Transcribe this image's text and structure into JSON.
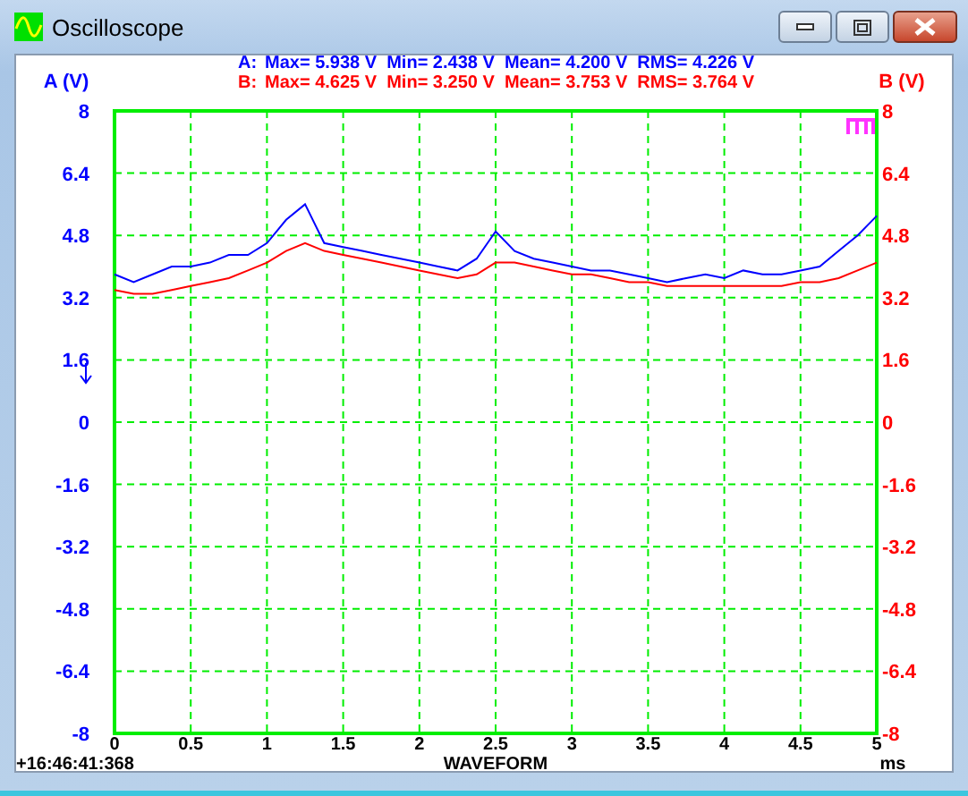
{
  "window": {
    "title": "Oscilloscope"
  },
  "scope": {
    "stats": [
      {
        "text": "Max= 5.938 V  Min= 2.438 V  Mean= 4.200 V  RMS= 4.226 V",
        "color": "#0000ff"
      },
      {
        "text": "Max= 4.625 V  Min= 3.250 V  Mean= 3.753 V  RMS= 3.764 V",
        "color": "#ff0000"
      }
    ],
    "timestamp": "+16:46:41:368",
    "x_unit": "ms",
    "right_axis": {
      "label": "B (V)",
      "ticks": [
        "8",
        "6.4",
        "4.8",
        "3.2",
        "1.6",
        "0",
        "-1.6",
        "-3.2",
        "-4.8",
        "-6.4",
        "-8"
      ]
    },
    "chart_data": {
      "type": "line",
      "grid": true,
      "xlabel": "WAVEFORM",
      "ylabel": "A (V)",
      "x": [
        0,
        0.125,
        0.25,
        0.375,
        0.5,
        0.625,
        0.75,
        0.875,
        1,
        1.125,
        1.25,
        1.375,
        1.5,
        1.625,
        1.75,
        1.875,
        2,
        2.125,
        2.25,
        2.375,
        2.5,
        2.625,
        2.75,
        2.875,
        3,
        3.125,
        3.25,
        3.375,
        3.5,
        3.625,
        3.75,
        3.875,
        4,
        4.125,
        4.25,
        4.375,
        4.5,
        4.625,
        4.75,
        4.875,
        5
      ],
      "series": [
        {
          "name": "A:",
          "color": "#0000ff",
          "values": [
            3.8,
            3.6,
            3.8,
            4.0,
            4.0,
            4.1,
            4.3,
            4.3,
            4.6,
            5.2,
            5.6,
            4.6,
            4.5,
            4.4,
            4.3,
            4.2,
            4.1,
            4.0,
            3.9,
            4.2,
            4.9,
            4.4,
            4.2,
            4.1,
            4.0,
            3.9,
            3.9,
            3.8,
            3.7,
            3.6,
            3.7,
            3.8,
            3.7,
            3.9,
            3.8,
            3.8,
            3.9,
            4.0,
            4.4,
            4.8,
            5.3
          ]
        },
        {
          "name": "B:",
          "color": "#ff0000",
          "values": [
            3.4,
            3.3,
            3.3,
            3.4,
            3.5,
            3.6,
            3.7,
            3.9,
            4.1,
            4.4,
            4.6,
            4.4,
            4.3,
            4.2,
            4.1,
            4.0,
            3.9,
            3.8,
            3.7,
            3.8,
            4.1,
            4.1,
            4.0,
            3.9,
            3.8,
            3.8,
            3.7,
            3.6,
            3.6,
            3.5,
            3.5,
            3.5,
            3.5,
            3.5,
            3.5,
            3.5,
            3.6,
            3.6,
            3.7,
            3.9,
            4.1
          ]
        }
      ],
      "xlim": [
        0,
        5
      ],
      "ylim": [
        -8,
        8
      ],
      "xticks": [
        {
          "value": 0,
          "label": "0"
        },
        {
          "value": 0.5,
          "label": "0.5"
        },
        {
          "value": 1,
          "label": "1"
        },
        {
          "value": 1.5,
          "label": "1.5"
        },
        {
          "value": 2,
          "label": "2"
        },
        {
          "value": 2.5,
          "label": "2.5"
        },
        {
          "value": 3,
          "label": "3"
        },
        {
          "value": 3.5,
          "label": "3.5"
        },
        {
          "value": 4,
          "label": "4"
        },
        {
          "value": 4.5,
          "label": "4.5"
        },
        {
          "value": 5,
          "label": "5"
        }
      ],
      "yticks": [
        {
          "value": 8,
          "label": "8"
        },
        {
          "value": 6.4,
          "label": "6.4"
        },
        {
          "value": 4.8,
          "label": "4.8"
        },
        {
          "value": 3.2,
          "label": "3.2"
        },
        {
          "value": 1.6,
          "label": "1.6"
        },
        {
          "value": 0,
          "label": "0"
        },
        {
          "value": -1.6,
          "label": "-1.6"
        },
        {
          "value": -3.2,
          "label": "-3.2"
        },
        {
          "value": -4.8,
          "label": "-4.8"
        },
        {
          "value": -6.4,
          "label": "-6.4"
        },
        {
          "value": -8,
          "label": "-8"
        }
      ]
    }
  }
}
